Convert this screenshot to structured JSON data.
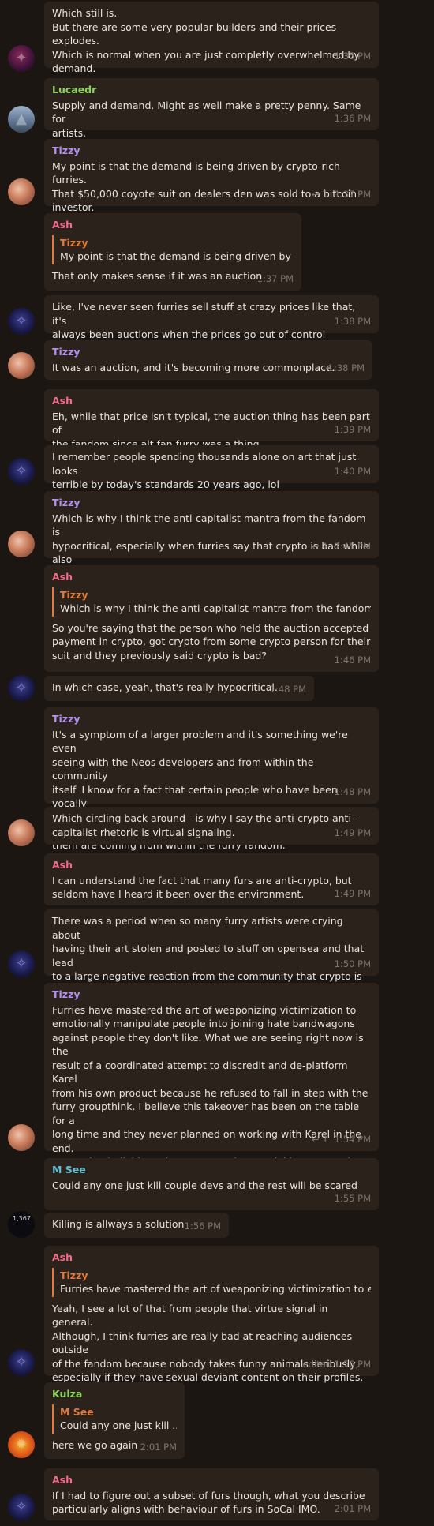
{
  "colors": {
    "background": "#1b1612",
    "bubble": "#2b221c",
    "lucaedr": "#8bd35e",
    "tizzy": "#b48ef0",
    "ash": "#f36b8a",
    "msee": "#5ec0d3",
    "kulza": "#8bd35e",
    "quote_accent": "#e07a3c",
    "timestamp": "#7e756c"
  },
  "messages": [
    {
      "id": "m0",
      "text": "Which still is.\nBut there are some very popular builders and their prices explodes.\nWhich is normal when you are just completly overwhelmed by\ndemand.",
      "time": "1:35 PM",
      "avatar_icon": "purple-fox-avatar"
    },
    {
      "id": "m1",
      "sender": "Lucaedr",
      "text": "Supply and demand. Might as well make a pretty penny. Same for\nartists.",
      "time": "1:36 PM",
      "avatar_icon": "mountain-avatar"
    },
    {
      "id": "m2",
      "sender": "Tizzy",
      "text": "My point is that the demand is being driven by crypto-rich furries.\nThat $50,000 coyote suit on dealers den was sold to a bitcoin\ninvestor.",
      "replies": "1",
      "time": "1:37 PM",
      "avatar_icon": "fox-avatar"
    },
    {
      "id": "m3",
      "sender": "Ash",
      "quote": {
        "sender": "Tizzy",
        "text": "My point is that the demand is being driven by c..."
      },
      "text": "That only makes sense if it was an auction",
      "time": "1:37 PM"
    },
    {
      "id": "m4",
      "text": "Like, I've never seen furries sell stuff at crazy prices like that, it's\nalways been auctions when the prices go out of control",
      "time": "1:38 PM",
      "avatar_icon": "dark-avatar"
    },
    {
      "id": "m5",
      "sender": "Tizzy",
      "text": "It was an auction, and it's becoming more commonplace.",
      "time": "1:38 PM",
      "avatar_icon": "fox-avatar"
    },
    {
      "id": "m6",
      "sender": "Ash",
      "text": "Eh, while that price isn't typical, the auction thing has been part of\nthe fandom since alt.fan.furry was a thing.",
      "time": "1:39 PM"
    },
    {
      "id": "m7",
      "text": "I remember people spending thousands alone on art that just looks\nterrible by today's standards 20 years ago, lol",
      "time": "1:40 PM",
      "avatar_icon": "dark-avatar"
    },
    {
      "id": "m8",
      "sender": "Tizzy",
      "text": "Which is why I think the anti-capitalist mantra from the fandom is\nhypocritical, especially when furries say that crypto is bad while also\nprofiting from it.",
      "replies": "1",
      "time": "1:41 PM",
      "avatar_icon": "fox-avatar"
    },
    {
      "id": "m9",
      "sender": "Ash",
      "quote": {
        "sender": "Tizzy",
        "text": "Which is why I think the anti-capitalist mantra from the fandom i..."
      },
      "text": "So you're saying that the person who held the auction accepted\npayment in crypto, got crypto from some crypto person for their\nsuit and they previously said crypto is bad?",
      "time": "1:46 PM"
    },
    {
      "id": "m10",
      "text": "In which case, yeah, that's really hypocritical.",
      "time": "1:48 PM",
      "avatar_icon": "dark-avatar"
    },
    {
      "id": "m11",
      "sender": "Tizzy",
      "text": "It's a symptom of a larger problem and it's something we're even\nseeing with the Neos developers and from within the community\nitself. I know for a fact that certain people who have been vocally\nanti-crypto have also greatly profited from NCR, and the majority of\nthem are coming from within the furry fandom.",
      "time": "1:48 PM"
    },
    {
      "id": "m12",
      "text": "Which circling back around - is why I say the anti-crypto anti-\ncapitalist rhetoric is virtual signaling.",
      "time": "1:49 PM",
      "avatar_icon": "fox-avatar"
    },
    {
      "id": "m13",
      "sender": "Ash",
      "text": "I can understand the fact that many furs are anti-crypto, but\nseldom have I heard it been over the environment.",
      "time": "1:49 PM"
    },
    {
      "id": "m14",
      "text": "There was a period when so many furry artists were crying about\nhaving their art stolen and posted to stuff on opensea and that lead\nto a large negative reaction from the community that crypto is just\na scam every time.",
      "time": "1:50 PM",
      "avatar_icon": "dark-avatar"
    },
    {
      "id": "m15",
      "sender": "Tizzy",
      "text": "Furries have mastered the art of weaponizing victimization to\nemotionally manipulate people into joining hate bandwagons\nagainst people they don't like. What we are seeing right now is the\nresult of a coordinated attempt to discredit and de-platform Karel\nfrom his own product because he refused to fall in step with the\nfurry groupthink. I believe this takeover has been on the table for a\nlong time and they never planned on working with Karel in the end.\nIt's textbook divide and conquer tactics. By sinking NCR and\ndividing the community, they believe they are minimizing Karel's\ninvolvement.",
      "replies": "1",
      "time": "1:54 PM",
      "avatar_icon": "fox-avatar"
    },
    {
      "id": "m16",
      "sender": "M See",
      "text": "Could any one just kill couple devs and the rest will be scared",
      "time": "1:55 PM"
    },
    {
      "id": "m17",
      "text": "Killing is allways a solution",
      "time": "1:56 PM",
      "avatar_icon": "msee-avatar",
      "avatar_text": "1,367"
    },
    {
      "id": "m18",
      "sender": "Ash",
      "quote": {
        "sender": "Tizzy",
        "text": "Furries have mastered the art of weaponizing victimization to e..."
      },
      "text": "Yeah, I see a lot of that from people that virtue signal in general.\nAlthough, I think furries are really bad at reaching audiences outside\nof the fandom because nobody takes funny animals seriously,\nespecially if they have sexual deviant content on their profiles.",
      "time": "edited 1:56 PM",
      "avatar_icon": "dark-avatar"
    },
    {
      "id": "m19",
      "sender": "Kulza",
      "quote": {
        "sender": "M See",
        "text": "Could any one just kill ..."
      },
      "text": "here we go again",
      "time": "2:01 PM",
      "avatar_icon": "kulza-avatar"
    },
    {
      "id": "m20",
      "sender": "Ash",
      "text": "If I had to figure out a subset of furs though, what you describe\nparticularly aligns with behaviour of furs in SoCal IMO.",
      "time": "2:01 PM",
      "avatar_icon": "dark-avatar"
    }
  ]
}
